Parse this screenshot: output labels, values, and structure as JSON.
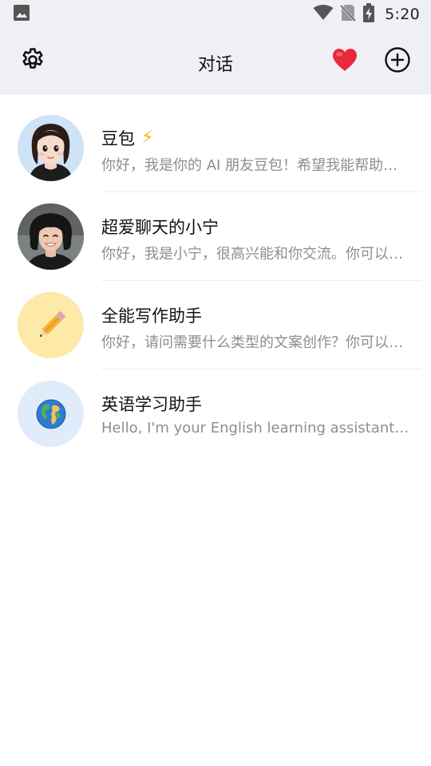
{
  "status_bar": {
    "time": "5:20",
    "icons": [
      "image-icon",
      "wifi-icon",
      "no-sim-icon",
      "battery-charging-icon"
    ]
  },
  "header": {
    "title": "对话",
    "settings_icon": "gear-icon",
    "favorite_icon": "heart-icon",
    "add_icon": "plus-circle-icon"
  },
  "colors": {
    "header_bg": "#eef0f5",
    "heart": "#e8293c",
    "preview_text": "#8e8e93",
    "bolt": "#f6b400"
  },
  "conversations": [
    {
      "name": "豆包",
      "badge_icon": "lightning-icon",
      "preview": "你好，我是你的 AI 朋友豆包！希望我能帮助到你",
      "avatar": "cartoon-girl-avatar"
    },
    {
      "name": "超爱聊天的小宁",
      "preview": "你好，我是小宁，很高兴能和你交流。你可以和我聊聊天",
      "avatar": "smiling-woman-avatar"
    },
    {
      "name": "全能写作助手",
      "preview": "你好，请问需要什么类型的文案创作？你可以告诉我",
      "avatar": "pencil-avatar"
    },
    {
      "name": "英语学习助手",
      "preview": "Hello, I'm your English learning assistant. Let's learn together",
      "avatar": "globe-avatar"
    }
  ]
}
